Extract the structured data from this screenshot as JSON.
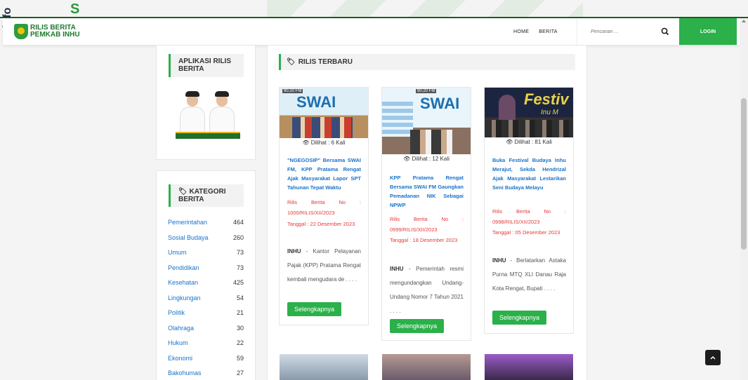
{
  "watermark": {
    "word": "info",
    "letter": "S"
  },
  "brand": {
    "line1": "RILIS BERITA",
    "line2": "PEMKAB INHU"
  },
  "nav": {
    "home": "HOME",
    "berita": "BERITA"
  },
  "search": {
    "placeholder": "Pencarian ..."
  },
  "login": "LOGIN",
  "sidebar": {
    "apps_title_1": "APLIKASI RILIS",
    "apps_title_2": "BERITA",
    "categories_title_1": "KATEGORI",
    "categories_title_2": "BERITA",
    "categories": [
      {
        "name": "Pemerintahan",
        "count": "464"
      },
      {
        "name": "Sosial Budaya",
        "count": "260"
      },
      {
        "name": "Umum",
        "count": "73"
      },
      {
        "name": "Pendidikan",
        "count": "73"
      },
      {
        "name": "Kesehatan",
        "count": "425"
      },
      {
        "name": "Lingkungan",
        "count": "54"
      },
      {
        "name": "Politik",
        "count": "21"
      },
      {
        "name": "Olahraga",
        "count": "30"
      },
      {
        "name": "Hukum",
        "count": "22"
      },
      {
        "name": "Ekonomi",
        "count": "59"
      },
      {
        "name": "Bakohumas",
        "count": "27"
      }
    ]
  },
  "main": {
    "title": "RILIS TERBARU",
    "posts": [
      {
        "views": "Dilihat : 6 Kali",
        "image_text": "SWAI",
        "image_freq": "90.20 FM",
        "title": "\"NGEGOSIP\" Bersama SWAI FM, KPP Pratama Rengat Ajak Masyarakat Lapor SPT Tahunan Tepat Waktu",
        "meta1": "Rilis Berita No : 1000/RILIS/XII/2023",
        "meta2": "Tanggal : 22 Desember 2023",
        "excerpt_lead": "INHU",
        "excerpt": " - Kantor Pelayanan Pajak (KPP) Pratama Rengat kembali mengudara de . . . .",
        "button": "Selengkapnya"
      },
      {
        "views": "Dilihat : 12 Kali",
        "image_text": "SWAI",
        "image_freq": "90.20 FM",
        "title": "KPP Pratama Rengat Bersama SWAI FM Gaungkan Pemadanan NIK Sebagai NPWP",
        "meta1": "Rilis Berita No : 0999/RILIS/XII/2023",
        "meta2": "Tanggal : 18 Desember 2023",
        "excerpt_lead": "INHU",
        "excerpt": " - Pemerintah resmi mengundangkan Undang-Undang Nomor 7 Tahun 2021 . . . .",
        "button": "Selengkapnya"
      },
      {
        "views": "Dilihat : 81 Kali",
        "image_text": "Festiv",
        "image_sub": "Inu M",
        "title": "Buka Festival Budaya Inhu Merajut, Sekda Hendrizal Ajak Masyarakat Lestarikan Seni Budaya Melayu",
        "meta1": "Rilis Berita No : 0998/RILIS/XII/2023",
        "meta2": "Tanggal : 05 Desember 2023",
        "excerpt_lead": "INHU",
        "excerpt": " - Berlatarkan Astaka Purna MTQ XLI Danau Raja Kota Rengat, Bupati . . . .",
        "button": "Selengkapnya"
      }
    ]
  },
  "colors": {
    "accent": "#2bb04a",
    "link": "#1a73c9",
    "meta": "#e53935",
    "dark": "#1b5e20"
  }
}
